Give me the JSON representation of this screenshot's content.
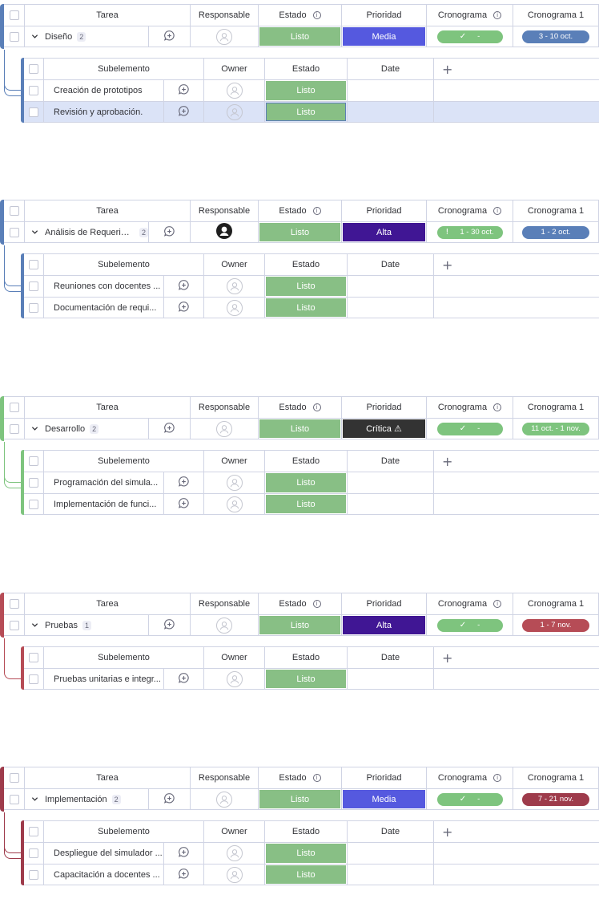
{
  "columns": {
    "task": "Tarea",
    "owner": "Responsable",
    "status": "Estado",
    "priority": "Prioridad",
    "timeline": "Cronograma",
    "timeline1": "Cronograma 1"
  },
  "sub_columns": {
    "name": "Subelemento",
    "owner": "Owner",
    "status": "Estado",
    "date": "Date",
    "add": "+"
  },
  "groups": [
    {
      "color": "#5a7fb8",
      "name": "Diseño",
      "count": "2",
      "status": "Listo",
      "priority": "Media",
      "priority_color": "#5559df",
      "timeline": "-",
      "timeline_color": "#7ec47e",
      "timeline_icon": "check",
      "timeline1": "3 - 10 oct.",
      "timeline1_color": "#5a7fb8",
      "owner_avatar": "empty",
      "subitems": [
        {
          "name": "Creación de prototipos",
          "status": "Listo"
        },
        {
          "name": "Revisión y aprobación.",
          "status": "Listo",
          "selected": true
        }
      ]
    },
    {
      "color": "#5a7fb8",
      "name": "Análisis de Requerim...",
      "count": "2",
      "status": "Listo",
      "priority": "Alta",
      "priority_color": "#401694",
      "timeline": "1 - 30 oct.",
      "timeline_color": "#7ec47e",
      "timeline_icon": "!",
      "timeline1": "1 - 2 oct.",
      "timeline1_color": "#5a7fb8",
      "owner_avatar": "filled",
      "subitems": [
        {
          "name": "Reuniones con docentes ...",
          "status": "Listo"
        },
        {
          "name": "Documentación de requi...",
          "status": "Listo"
        }
      ]
    },
    {
      "color": "#7ec47e",
      "name": "Desarrollo",
      "count": "2",
      "status": "Listo",
      "priority": "Crítica ⚠",
      "priority_color": "#333333",
      "timeline": "-",
      "timeline_color": "#7ec47e",
      "timeline_icon": "check",
      "timeline1": "11 oct. - 1 nov.",
      "timeline1_color": "#7ec47e",
      "owner_avatar": "empty",
      "subitems": [
        {
          "name": "Programación del simula...",
          "status": "Listo"
        },
        {
          "name": "Implementación de funci...",
          "status": "Listo"
        }
      ]
    },
    {
      "color": "#b64c56",
      "name": "Pruebas",
      "count": "1",
      "status": "Listo",
      "priority": "Alta",
      "priority_color": "#401694",
      "timeline": "-",
      "timeline_color": "#7ec47e",
      "timeline_icon": "check",
      "timeline1": "1 - 7 nov.",
      "timeline1_color": "#b64c56",
      "owner_avatar": "empty",
      "subitems": [
        {
          "name": "Pruebas unitarias e integr...",
          "status": "Listo"
        }
      ]
    },
    {
      "color": "#9e3b4b",
      "name": "Implementación",
      "count": "2",
      "status": "Listo",
      "priority": "Media",
      "priority_color": "#5559df",
      "timeline": "-",
      "timeline_color": "#7ec47e",
      "timeline_icon": "check",
      "timeline1": "7 - 21 nov.",
      "timeline1_color": "#9e3b4b",
      "owner_avatar": "empty",
      "subitems": [
        {
          "name": "Despliegue del simulador ...",
          "status": "Listo"
        },
        {
          "name": "Capacitación a docentes ...",
          "status": "Listo"
        }
      ]
    }
  ],
  "status_color": "#88bf85"
}
